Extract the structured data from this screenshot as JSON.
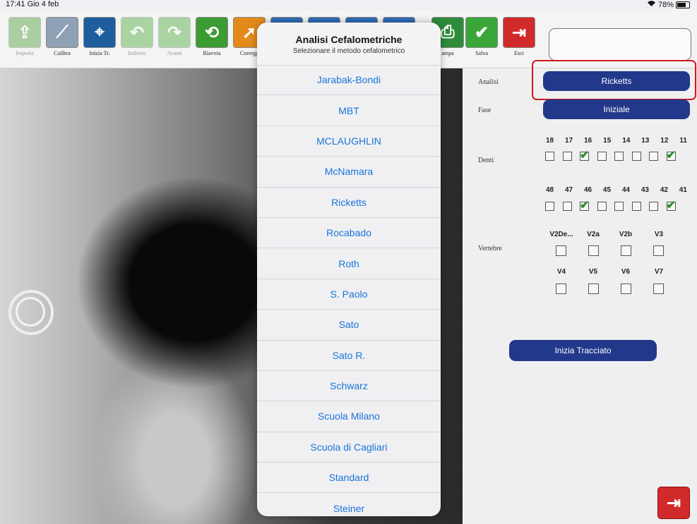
{
  "status": {
    "time": "17:41",
    "date": "Gio 4 feb",
    "wifi": "wifi-icon",
    "battery": "78%",
    "battery_level": 0.78
  },
  "toolbar": {
    "items": [
      {
        "label": "Importa",
        "icon": "import-icon",
        "glyph": "⇪",
        "color": "#4fa23b",
        "enabled": false
      },
      {
        "label": "Calibra",
        "icon": "calibrate-icon",
        "glyph": "⟋",
        "color": "#8fa1b4",
        "enabled": true
      },
      {
        "label": "Inizia Tr.",
        "icon": "start-tracing-icon",
        "glyph": "⌖",
        "color": "#1f5e9e",
        "enabled": true
      },
      {
        "label": "Indietro",
        "icon": "undo-icon",
        "glyph": "↶",
        "color": "#4fae3d",
        "enabled": false
      },
      {
        "label": "Avanti",
        "icon": "redo-icon",
        "glyph": "↷",
        "color": "#4fae3d",
        "enabled": false
      },
      {
        "label": "Riavvia",
        "icon": "restart-icon",
        "glyph": "⟲",
        "color": "#3c9c34",
        "enabled": true
      },
      {
        "label": "Corregg",
        "icon": "correct-icon",
        "glyph": "➚",
        "color": "#e48a1b",
        "enabled": true
      },
      {
        "label": "",
        "icon": "tool-icon-1",
        "glyph": "✕",
        "color": "#2d6db5",
        "enabled": true
      },
      {
        "label": "",
        "icon": "tool-icon-2",
        "glyph": "▣",
        "color": "#2d6db5",
        "enabled": true
      },
      {
        "label": "",
        "icon": "tool-icon-3",
        "glyph": "⤢",
        "color": "#2d6db5",
        "enabled": true
      },
      {
        "label": "",
        "icon": "tool-icon-4",
        "glyph": "✖",
        "color": "#2d6db5",
        "enabled": true
      },
      {
        "label": "ampa",
        "icon": "print-icon",
        "glyph": "⎙",
        "color": "#2e8b3a",
        "enabled": true
      },
      {
        "label": "Salva",
        "icon": "save-icon",
        "glyph": "✔",
        "color": "#3aa63a",
        "enabled": true
      },
      {
        "label": "Esci",
        "icon": "exit-icon",
        "glyph": "⇥",
        "color": "#d12a2a",
        "enabled": true
      }
    ],
    "top_input_value": ""
  },
  "popup": {
    "title": "Analisi Cefalometriche",
    "subtitle": "Selezionare il metodo cefalometrico",
    "options": [
      "Jarabak-Bondi",
      "MBT",
      "MCLAUGHLIN",
      "McNamara",
      "Ricketts",
      "Rocabado",
      "Roth",
      "S. Paolo",
      "Sato",
      "Sato R.",
      "Schwarz",
      "Scuola Milano",
      "Scuola di Cagliari",
      "Standard",
      "Steiner"
    ]
  },
  "panel": {
    "analisi_label": "Analisi",
    "analisi_value": "Ricketts",
    "fase_label": "Fase",
    "fase_value": "Iniziale",
    "denti_label": "Denti",
    "upper_teeth": [
      "18",
      "17",
      "16",
      "15",
      "14",
      "13",
      "12",
      "11"
    ],
    "upper_checked": [
      false,
      false,
      true,
      false,
      false,
      false,
      false,
      true
    ],
    "lower_teeth": [
      "48",
      "47",
      "46",
      "45",
      "44",
      "43",
      "42",
      "41"
    ],
    "lower_checked": [
      false,
      false,
      true,
      false,
      false,
      false,
      false,
      true
    ],
    "vertebre_label": "Vertebre",
    "vertebre_row1": [
      "V2De...",
      "V2a",
      "V2b",
      "V3"
    ],
    "vertebre_row2": [
      "V4",
      "V5",
      "V6",
      "V7"
    ],
    "start_button": "Inizia Tracciato",
    "exit_icon": "exit-icon"
  },
  "colors": {
    "accent_blue": "#22388a",
    "link_blue": "#1a73d8",
    "highlight_red": "#d0191c",
    "check_green": "#2a8f2a"
  }
}
